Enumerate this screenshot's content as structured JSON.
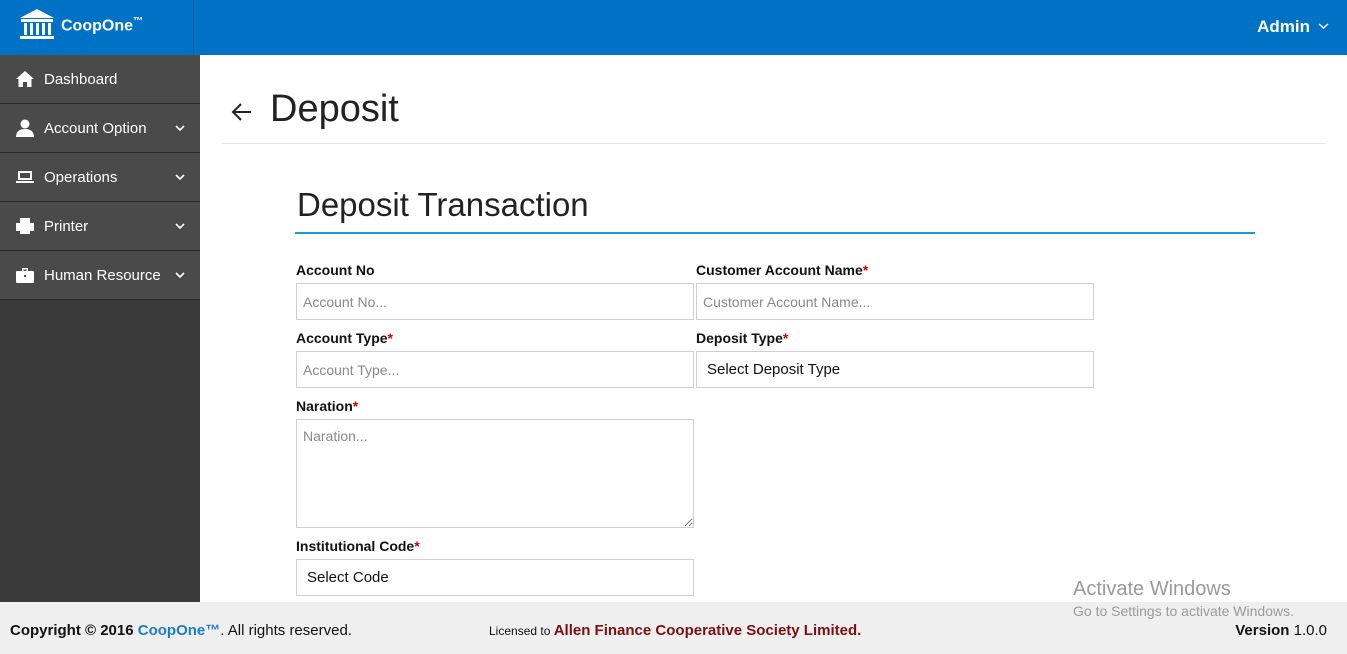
{
  "app": {
    "brand": "CoopOne",
    "brand_tm": "™",
    "user": "Admin"
  },
  "sidebar": {
    "items": [
      {
        "label": "Dashboard",
        "icon": "home-icon"
      },
      {
        "label": "Account Option",
        "icon": "user-icon"
      },
      {
        "label": "Operations",
        "icon": "laptop-icon"
      },
      {
        "label": "Printer",
        "icon": "printer-icon"
      },
      {
        "label": "Human Resource",
        "icon": "briefcase-icon"
      }
    ]
  },
  "page": {
    "title": "Deposit",
    "section_title": "Deposit Transaction"
  },
  "form": {
    "account_no": {
      "label": "Account No",
      "placeholder": "Account No..."
    },
    "customer_name": {
      "label": "Customer Account Name",
      "placeholder": "Customer Account Name..."
    },
    "account_type": {
      "label": "Account Type",
      "placeholder": "Account Type..."
    },
    "deposit_type": {
      "label": "Deposit Type",
      "value": "Select Deposit Type"
    },
    "naration": {
      "label": "Naration",
      "placeholder": "Naration..."
    },
    "institutional_code": {
      "label": "Institutional Code",
      "value": "Select Code"
    },
    "required_mark": "*"
  },
  "footer": {
    "copyright_prefix": "Copyright © 2016 ",
    "brand": "CoopOne™",
    "copyright_suffix": ". All rights reserved.",
    "licensed_prefix": "Licensed to ",
    "org": "Allen Finance Cooperative Society Limited",
    "org_suffix": ".",
    "version_label": "Version",
    "version_value": "1.0.0"
  },
  "watermark": {
    "line1": "Activate Windows",
    "line2": "Go to Settings to activate Windows."
  },
  "colors": {
    "topbar": "#0072c6",
    "sidebar": "#4a4a4a",
    "accent_rule": "#1a9ad6",
    "required": "#cc0000",
    "org_text": "#7a1010"
  }
}
